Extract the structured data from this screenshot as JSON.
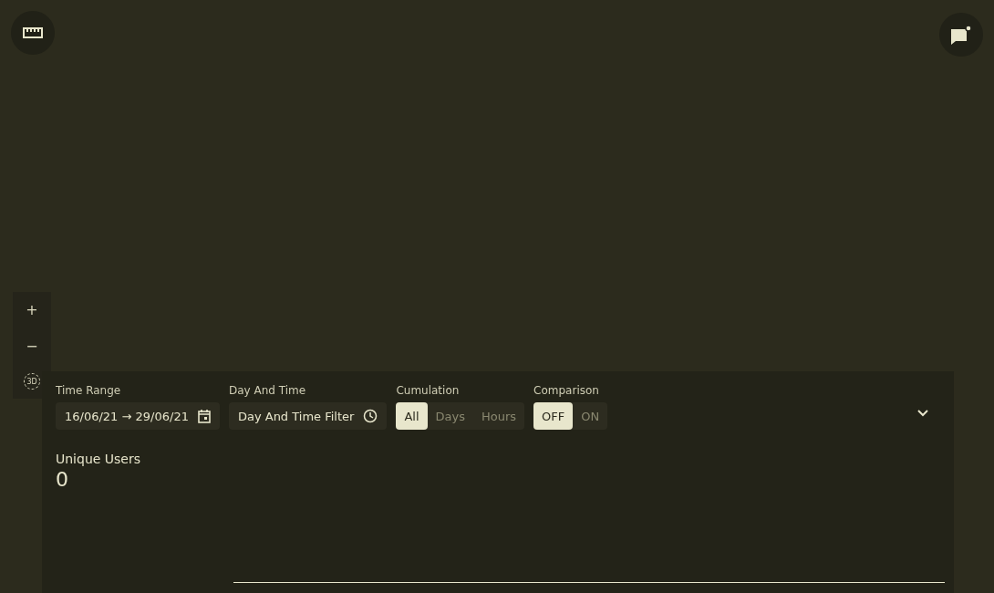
{
  "map_controls": {
    "zoom_in": "+",
    "zoom_out": "−",
    "tilt": "3D"
  },
  "filters": {
    "time_range": {
      "label": "Time Range",
      "value": "16/06/21 → 29/06/21"
    },
    "day_and_time": {
      "label": "Day And Time",
      "value": "Day And Time Filter"
    },
    "cumulation": {
      "label": "Cumulation",
      "options": [
        {
          "label": "All",
          "selected": true
        },
        {
          "label": "Days",
          "selected": false
        },
        {
          "label": "Hours",
          "selected": false
        }
      ]
    },
    "comparison": {
      "label": "Comparison",
      "options": [
        {
          "label": "OFF",
          "selected": true
        },
        {
          "label": "ON",
          "selected": false
        }
      ]
    }
  },
  "stat": {
    "label": "Unique Users",
    "value": "0"
  }
}
